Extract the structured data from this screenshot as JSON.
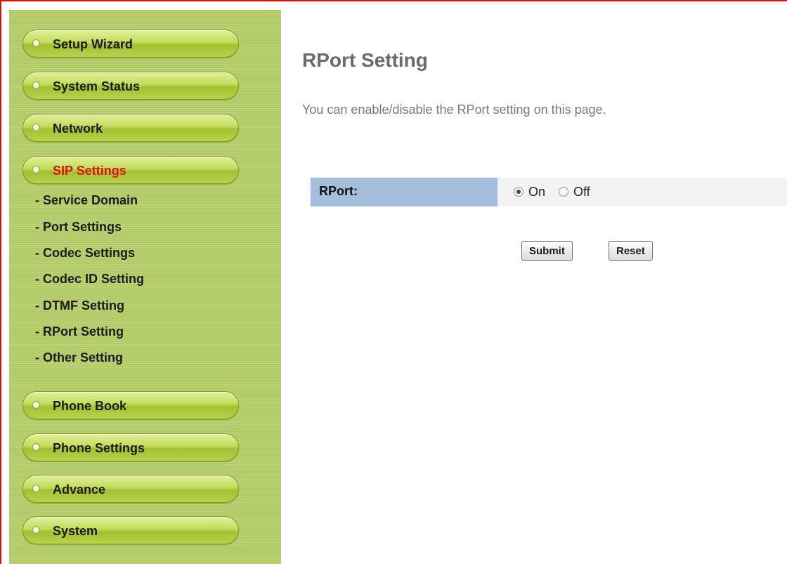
{
  "sidebar": {
    "menu": [
      {
        "label": "Setup Wizard"
      },
      {
        "label": "System Status"
      },
      {
        "label": "Network"
      },
      {
        "label": "SIP Settings",
        "active": true
      }
    ],
    "sip_submenu": [
      "- Service Domain",
      "- Port Settings",
      "- Codec Settings",
      "- Codec ID Setting",
      "- DTMF Setting",
      "- RPort Setting",
      "- Other Setting"
    ],
    "menu_after": [
      {
        "label": "Phone Book"
      },
      {
        "label": "Phone Settings"
      },
      {
        "label": "Advance"
      },
      {
        "label": "System"
      }
    ]
  },
  "main": {
    "title": "RPort Setting",
    "description": "You can enable/disable the RPort setting on this page.",
    "form": {
      "rport_label": "RPort:",
      "options": [
        {
          "label": "On",
          "selected": true
        },
        {
          "label": "Off",
          "selected": false
        }
      ]
    },
    "buttons": {
      "submit": "Submit",
      "reset": "Reset"
    }
  },
  "colors": {
    "sidebar_bg": "#b8cf6a",
    "active_menu_text": "#e01010",
    "form_label_bg": "#a5bedc",
    "frame_border": "#e01010"
  }
}
